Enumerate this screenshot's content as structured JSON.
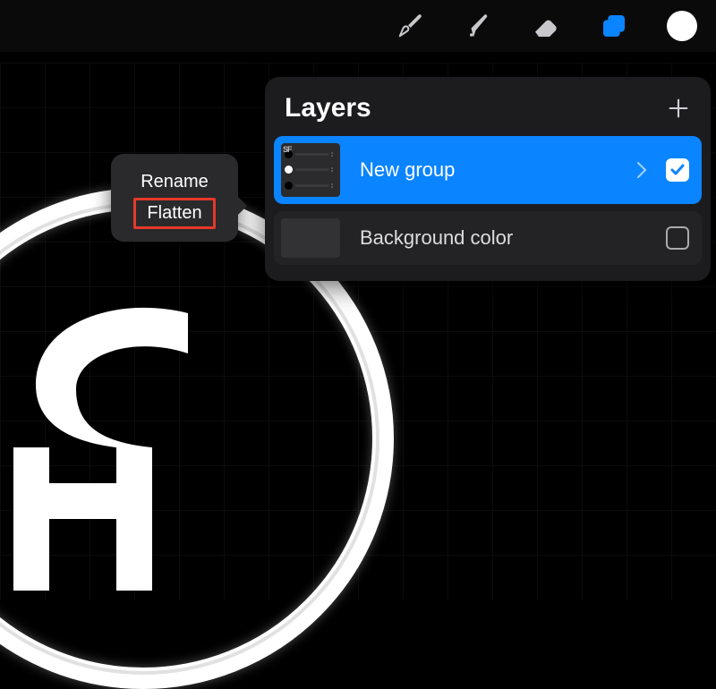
{
  "toolbar": {
    "brush_icon": "brush-icon",
    "smudge_icon": "smudge-icon",
    "eraser_icon": "eraser-icon",
    "layers_icon": "layers-icon",
    "color_icon": "color-chip",
    "active_color": "#ffffff",
    "layers_active": true
  },
  "layers_panel": {
    "title": "Layers",
    "add_icon": "plus-icon",
    "rows": [
      {
        "name": "New group",
        "selected": true,
        "expandable": true,
        "checked": true
      },
      {
        "name": "Background color",
        "selected": false,
        "expandable": false,
        "checked": false
      }
    ]
  },
  "context_menu": {
    "items": [
      {
        "label": "Rename",
        "highlighted": false
      },
      {
        "label": "Flatten",
        "highlighted": true
      }
    ]
  },
  "colors": {
    "accent": "#0a84ff",
    "highlight_box": "#e5392a",
    "panel_bg": "#1c1c1e"
  }
}
